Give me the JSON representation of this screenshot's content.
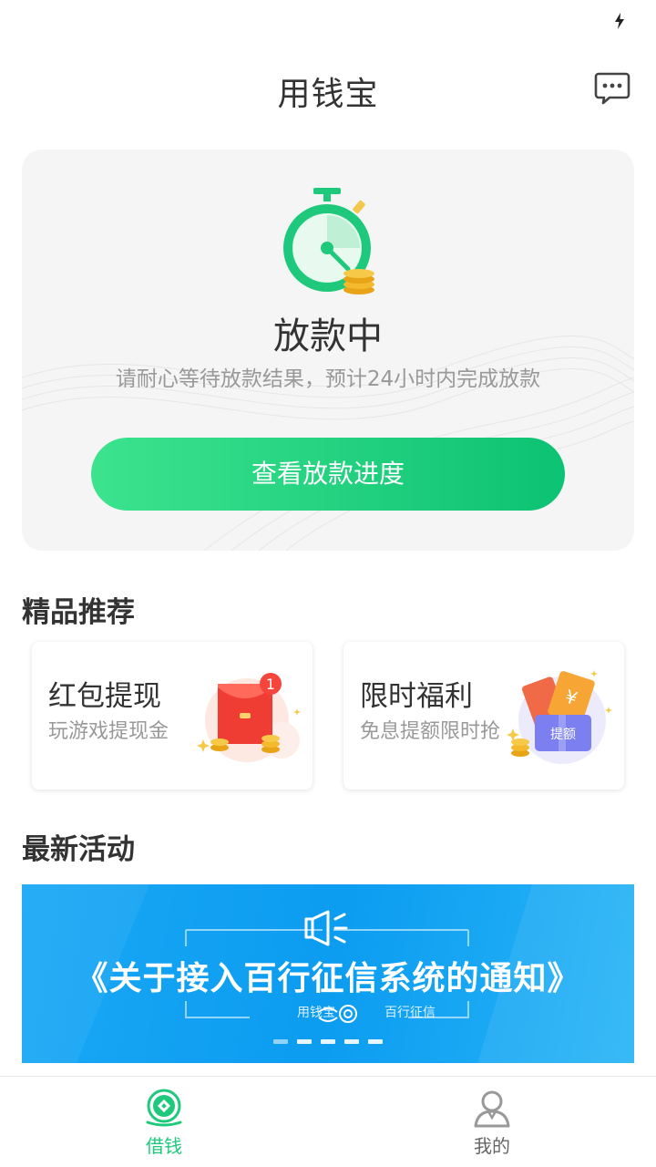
{
  "status_bar": {
    "icon": "charging-bolt-icon"
  },
  "header": {
    "title": "用钱宝",
    "message_icon": "chat-bubble-icon"
  },
  "loan_status": {
    "title": "放款中",
    "description": "请耐心等待放款结果，预计24小时内完成放款",
    "button_label": "查看放款进度",
    "icon": "stopwatch-coins-icon",
    "accent": "#1ec97b"
  },
  "recommend": {
    "section_title": "精品推荐",
    "cards": [
      {
        "title": "红包提现",
        "subtitle": "玩游戏提现金",
        "badge": "1",
        "icon": "red-envelope-icon"
      },
      {
        "title": "限时福利",
        "subtitle": "免息提额限时抢",
        "badge_text": "提额",
        "icon": "coupon-tickets-icon"
      }
    ]
  },
  "activities": {
    "section_title": "最新活动",
    "banner_text": "《关于接入百行征信系统的通知》",
    "brand_left": "用钱宝",
    "brand_right": "百行征信",
    "slides": 5,
    "active_slide": 1
  },
  "tabbar": {
    "items": [
      {
        "label": "借钱",
        "icon": "wallet-diamond-icon",
        "active": true,
        "color": "#1ec97b"
      },
      {
        "label": "我的",
        "icon": "user-profile-icon",
        "active": false,
        "color": "#666666"
      }
    ]
  }
}
